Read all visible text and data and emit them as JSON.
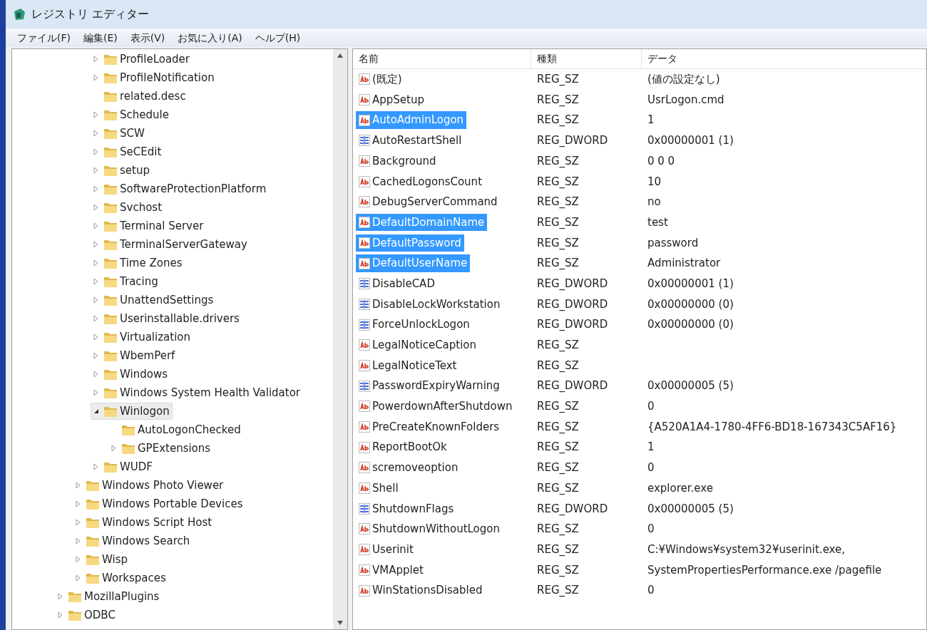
{
  "window": {
    "title": "レジストリ エディター"
  },
  "menu": [
    "ファイル(F)",
    "編集(E)",
    "表示(V)",
    "お気に入り(A)",
    "ヘルプ(H)"
  ],
  "tree": [
    {
      "children": [
        {
          "children": [
            {
              "label": "ProfileLoader",
              "expandable": true,
              "expanded": false,
              "selected": false
            },
            {
              "label": "ProfileNotification",
              "expandable": true,
              "expanded": false,
              "selected": false
            },
            {
              "label": "related.desc",
              "expandable": false,
              "selected": false
            },
            {
              "label": "Schedule",
              "expandable": true,
              "expanded": false,
              "selected": false
            },
            {
              "label": "SCW",
              "expandable": true,
              "expanded": false,
              "selected": false
            },
            {
              "label": "SeCEdit",
              "expandable": true,
              "expanded": false,
              "selected": false
            },
            {
              "label": "setup",
              "expandable": true,
              "expanded": false,
              "selected": false
            },
            {
              "label": "SoftwareProtectionPlatform",
              "expandable": true,
              "expanded": false,
              "selected": false
            },
            {
              "label": "Svchost",
              "expandable": true,
              "expanded": false,
              "selected": false
            },
            {
              "label": "Terminal Server",
              "expandable": true,
              "expanded": false,
              "selected": false
            },
            {
              "label": "TerminalServerGateway",
              "expandable": true,
              "expanded": false,
              "selected": false
            },
            {
              "label": "Time Zones",
              "expandable": true,
              "expanded": false,
              "selected": false
            },
            {
              "label": "Tracing",
              "expandable": true,
              "expanded": false,
              "selected": false
            },
            {
              "label": "UnattendSettings",
              "expandable": true,
              "expanded": false,
              "selected": false
            },
            {
              "label": "Userinstallable.drivers",
              "expandable": true,
              "expanded": false,
              "selected": false
            },
            {
              "label": "Virtualization",
              "expandable": true,
              "expanded": false,
              "selected": false
            },
            {
              "label": "WbemPerf",
              "expandable": true,
              "expanded": false,
              "selected": false
            },
            {
              "label": "Windows",
              "expandable": true,
              "expanded": false,
              "selected": false
            },
            {
              "label": "Windows System Health Validator",
              "expandable": true,
              "expanded": false,
              "selected": false
            },
            {
              "label": "Winlogon",
              "expandable": true,
              "expanded": true,
              "selected": true,
              "children": [
                {
                  "label": "AutoLogonChecked",
                  "expandable": false,
                  "selected": false
                },
                {
                  "label": "GPExtensions",
                  "expandable": true,
                  "expanded": false,
                  "selected": false
                }
              ]
            },
            {
              "label": "WUDF",
              "expandable": true,
              "expanded": false,
              "selected": false
            }
          ]
        },
        {
          "label": "Windows Photo Viewer",
          "expandable": true,
          "expanded": false,
          "selected": false
        },
        {
          "label": "Windows Portable Devices",
          "expandable": true,
          "expanded": false,
          "selected": false
        },
        {
          "label": "Windows Script Host",
          "expandable": true,
          "expanded": false,
          "selected": false
        },
        {
          "label": "Windows Search",
          "expandable": true,
          "expanded": false,
          "selected": false
        },
        {
          "label": "Wisp",
          "expandable": true,
          "expanded": false,
          "selected": false
        },
        {
          "label": "Workspaces",
          "expandable": true,
          "expanded": false,
          "selected": false
        }
      ]
    },
    {
      "label": "MozillaPlugins",
      "expandable": true,
      "expanded": false,
      "selected": false
    },
    {
      "label": "ODBC",
      "expandable": true,
      "expanded": false,
      "selected": false
    }
  ],
  "columns": [
    "名前",
    "種類",
    "データ"
  ],
  "values": [
    {
      "name": "(既定)",
      "type": "REG_SZ",
      "data": "(値の設定なし)",
      "kind": "string",
      "selected": false
    },
    {
      "name": "AppSetup",
      "type": "REG_SZ",
      "data": "UsrLogon.cmd",
      "kind": "string",
      "selected": false
    },
    {
      "name": "AutoAdminLogon",
      "type": "REG_SZ",
      "data": "1",
      "kind": "string",
      "selected": true
    },
    {
      "name": "AutoRestartShell",
      "type": "REG_DWORD",
      "data": "0x00000001 (1)",
      "kind": "binary",
      "selected": false
    },
    {
      "name": "Background",
      "type": "REG_SZ",
      "data": "0 0 0",
      "kind": "string",
      "selected": false
    },
    {
      "name": "CachedLogonsCount",
      "type": "REG_SZ",
      "data": "10",
      "kind": "string",
      "selected": false
    },
    {
      "name": "DebugServerCommand",
      "type": "REG_SZ",
      "data": "no",
      "kind": "string",
      "selected": false
    },
    {
      "name": "DefaultDomainName",
      "type": "REG_SZ",
      "data": "test",
      "kind": "string",
      "selected": true
    },
    {
      "name": "DefaultPassword",
      "type": "REG_SZ",
      "data": "password",
      "kind": "string",
      "selected": true
    },
    {
      "name": "DefaultUserName",
      "type": "REG_SZ",
      "data": "Administrator",
      "kind": "string",
      "selected": true
    },
    {
      "name": "DisableCAD",
      "type": "REG_DWORD",
      "data": "0x00000001 (1)",
      "kind": "binary",
      "selected": false
    },
    {
      "name": "DisableLockWorkstation",
      "type": "REG_DWORD",
      "data": "0x00000000 (0)",
      "kind": "binary",
      "selected": false
    },
    {
      "name": "ForceUnlockLogon",
      "type": "REG_DWORD",
      "data": "0x00000000 (0)",
      "kind": "binary",
      "selected": false
    },
    {
      "name": "LegalNoticeCaption",
      "type": "REG_SZ",
      "kind": "string",
      "selected": false
    },
    {
      "name": "LegalNoticeText",
      "type": "REG_SZ",
      "kind": "string",
      "selected": false
    },
    {
      "name": "PasswordExpiryWarning",
      "type": "REG_DWORD",
      "data": "0x00000005 (5)",
      "kind": "binary",
      "selected": false
    },
    {
      "name": "PowerdownAfterShutdown",
      "type": "REG_SZ",
      "data": "0",
      "kind": "string",
      "selected": false
    },
    {
      "name": "PreCreateKnownFolders",
      "type": "REG_SZ",
      "data": "{A520A1A4-1780-4FF6-BD18-167343C5AF16}",
      "kind": "string",
      "selected": false
    },
    {
      "name": "ReportBootOk",
      "type": "REG_SZ",
      "data": "1",
      "kind": "string",
      "selected": false
    },
    {
      "name": "scremoveoption",
      "type": "REG_SZ",
      "data": "0",
      "kind": "string",
      "selected": false
    },
    {
      "name": "Shell",
      "type": "REG_SZ",
      "data": "explorer.exe",
      "kind": "string",
      "selected": false
    },
    {
      "name": "ShutdownFlags",
      "type": "REG_DWORD",
      "data": "0x00000005 (5)",
      "kind": "binary",
      "selected": false
    },
    {
      "name": "ShutdownWithoutLogon",
      "type": "REG_SZ",
      "data": "0",
      "kind": "string",
      "selected": false
    },
    {
      "name": "Userinit",
      "type": "REG_SZ",
      "data": "C:¥Windows¥system32¥userinit.exe,",
      "kind": "string",
      "selected": false
    },
    {
      "name": "VMApplet",
      "type": "REG_SZ",
      "data": "SystemPropertiesPerformance.exe /pagefile",
      "kind": "string",
      "selected": false
    },
    {
      "name": "WinStationsDisabled",
      "type": "REG_SZ",
      "data": "0",
      "kind": "string",
      "selected": false
    }
  ]
}
